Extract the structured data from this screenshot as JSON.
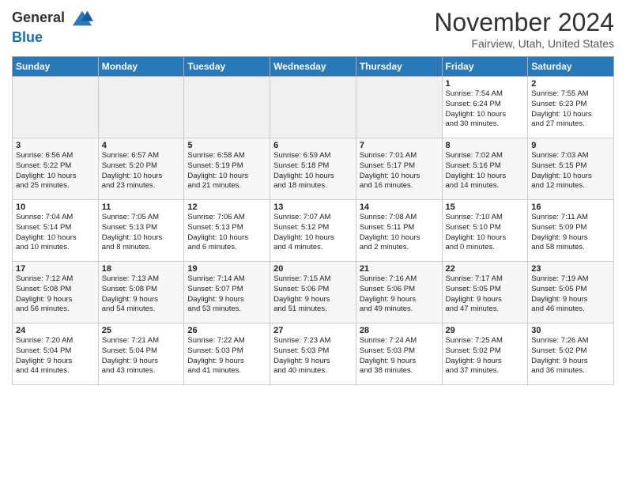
{
  "header": {
    "logo_general": "General",
    "logo_blue": "Blue",
    "month": "November 2024",
    "location": "Fairview, Utah, United States"
  },
  "weekdays": [
    "Sunday",
    "Monday",
    "Tuesday",
    "Wednesday",
    "Thursday",
    "Friday",
    "Saturday"
  ],
  "weeks": [
    [
      {
        "day": "",
        "info": "",
        "empty": true
      },
      {
        "day": "",
        "info": "",
        "empty": true
      },
      {
        "day": "",
        "info": "",
        "empty": true
      },
      {
        "day": "",
        "info": "",
        "empty": true
      },
      {
        "day": "",
        "info": "",
        "empty": true
      },
      {
        "day": "1",
        "info": "Sunrise: 7:54 AM\nSunset: 6:24 PM\nDaylight: 10 hours\nand 30 minutes."
      },
      {
        "day": "2",
        "info": "Sunrise: 7:55 AM\nSunset: 6:23 PM\nDaylight: 10 hours\nand 27 minutes."
      }
    ],
    [
      {
        "day": "3",
        "info": "Sunrise: 6:56 AM\nSunset: 5:22 PM\nDaylight: 10 hours\nand 25 minutes."
      },
      {
        "day": "4",
        "info": "Sunrise: 6:57 AM\nSunset: 5:20 PM\nDaylight: 10 hours\nand 23 minutes."
      },
      {
        "day": "5",
        "info": "Sunrise: 6:58 AM\nSunset: 5:19 PM\nDaylight: 10 hours\nand 21 minutes."
      },
      {
        "day": "6",
        "info": "Sunrise: 6:59 AM\nSunset: 5:18 PM\nDaylight: 10 hours\nand 18 minutes."
      },
      {
        "day": "7",
        "info": "Sunrise: 7:01 AM\nSunset: 5:17 PM\nDaylight: 10 hours\nand 16 minutes."
      },
      {
        "day": "8",
        "info": "Sunrise: 7:02 AM\nSunset: 5:16 PM\nDaylight: 10 hours\nand 14 minutes."
      },
      {
        "day": "9",
        "info": "Sunrise: 7:03 AM\nSunset: 5:15 PM\nDaylight: 10 hours\nand 12 minutes."
      }
    ],
    [
      {
        "day": "10",
        "info": "Sunrise: 7:04 AM\nSunset: 5:14 PM\nDaylight: 10 hours\nand 10 minutes."
      },
      {
        "day": "11",
        "info": "Sunrise: 7:05 AM\nSunset: 5:13 PM\nDaylight: 10 hours\nand 8 minutes."
      },
      {
        "day": "12",
        "info": "Sunrise: 7:06 AM\nSunset: 5:13 PM\nDaylight: 10 hours\nand 6 minutes."
      },
      {
        "day": "13",
        "info": "Sunrise: 7:07 AM\nSunset: 5:12 PM\nDaylight: 10 hours\nand 4 minutes."
      },
      {
        "day": "14",
        "info": "Sunrise: 7:08 AM\nSunset: 5:11 PM\nDaylight: 10 hours\nand 2 minutes."
      },
      {
        "day": "15",
        "info": "Sunrise: 7:10 AM\nSunset: 5:10 PM\nDaylight: 10 hours\nand 0 minutes."
      },
      {
        "day": "16",
        "info": "Sunrise: 7:11 AM\nSunset: 5:09 PM\nDaylight: 9 hours\nand 58 minutes."
      }
    ],
    [
      {
        "day": "17",
        "info": "Sunrise: 7:12 AM\nSunset: 5:08 PM\nDaylight: 9 hours\nand 56 minutes."
      },
      {
        "day": "18",
        "info": "Sunrise: 7:13 AM\nSunset: 5:08 PM\nDaylight: 9 hours\nand 54 minutes."
      },
      {
        "day": "19",
        "info": "Sunrise: 7:14 AM\nSunset: 5:07 PM\nDaylight: 9 hours\nand 53 minutes."
      },
      {
        "day": "20",
        "info": "Sunrise: 7:15 AM\nSunset: 5:06 PM\nDaylight: 9 hours\nand 51 minutes."
      },
      {
        "day": "21",
        "info": "Sunrise: 7:16 AM\nSunset: 5:06 PM\nDaylight: 9 hours\nand 49 minutes."
      },
      {
        "day": "22",
        "info": "Sunrise: 7:17 AM\nSunset: 5:05 PM\nDaylight: 9 hours\nand 47 minutes."
      },
      {
        "day": "23",
        "info": "Sunrise: 7:19 AM\nSunset: 5:05 PM\nDaylight: 9 hours\nand 46 minutes."
      }
    ],
    [
      {
        "day": "24",
        "info": "Sunrise: 7:20 AM\nSunset: 5:04 PM\nDaylight: 9 hours\nand 44 minutes."
      },
      {
        "day": "25",
        "info": "Sunrise: 7:21 AM\nSunset: 5:04 PM\nDaylight: 9 hours\nand 43 minutes."
      },
      {
        "day": "26",
        "info": "Sunrise: 7:22 AM\nSunset: 5:03 PM\nDaylight: 9 hours\nand 41 minutes."
      },
      {
        "day": "27",
        "info": "Sunrise: 7:23 AM\nSunset: 5:03 PM\nDaylight: 9 hours\nand 40 minutes."
      },
      {
        "day": "28",
        "info": "Sunrise: 7:24 AM\nSunset: 5:03 PM\nDaylight: 9 hours\nand 38 minutes."
      },
      {
        "day": "29",
        "info": "Sunrise: 7:25 AM\nSunset: 5:02 PM\nDaylight: 9 hours\nand 37 minutes."
      },
      {
        "day": "30",
        "info": "Sunrise: 7:26 AM\nSunset: 5:02 PM\nDaylight: 9 hours\nand 36 minutes."
      }
    ]
  ]
}
